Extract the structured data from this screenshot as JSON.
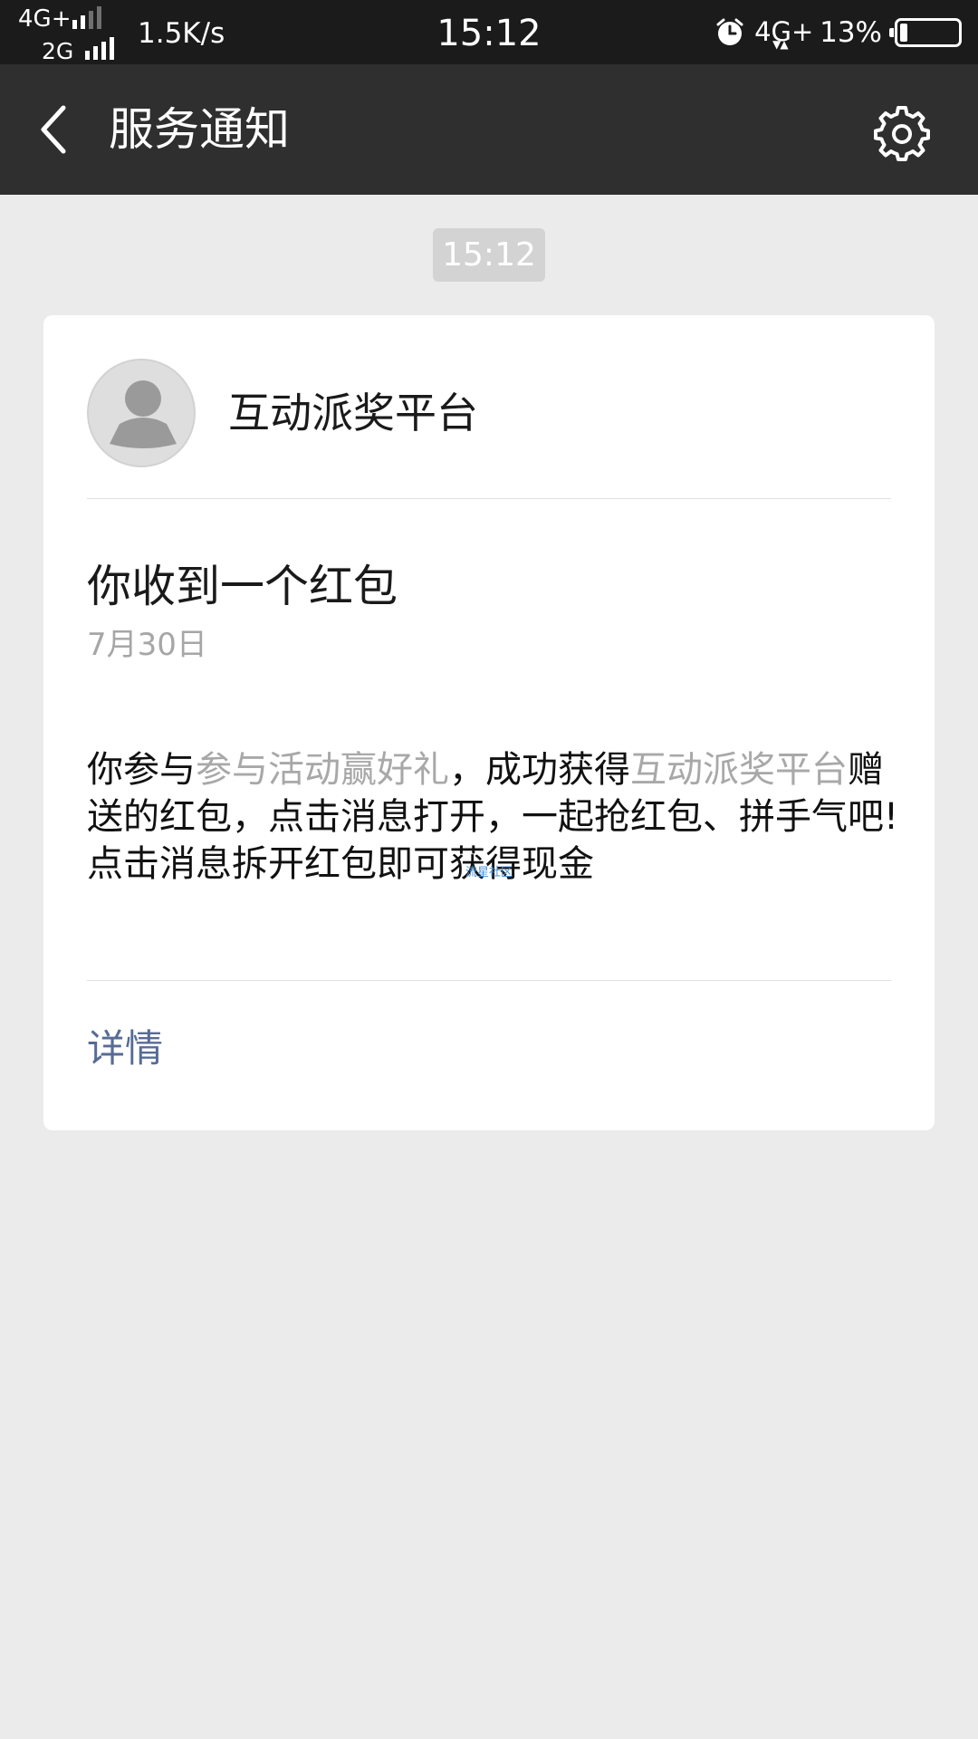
{
  "status_bar": {
    "network_top": "4G+",
    "network_bottom": "2G",
    "speed": "1.5K/s",
    "time": "15:12",
    "network_right": "4G+",
    "battery_percent": "13%",
    "battery_level": 0.13,
    "icons": [
      "signal-icon",
      "alarm-icon",
      "battery-icon"
    ]
  },
  "nav": {
    "title": "服务通知",
    "back_icon": "chevron-left-icon",
    "settings_icon": "gear-icon"
  },
  "timestamp": "15:12",
  "card": {
    "sender": "互动派奖平台",
    "avatar_icon": "default-user-avatar",
    "title": "你收到一个红包",
    "date": "7月30日",
    "body": {
      "part1": "你参与",
      "part2": "参与活动赢好礼",
      "part3": "，成功获得",
      "part4": "互动派奖平台",
      "part5": "赠送的红包，点击消息打开，一起抢红包、拼手气吧!",
      "line2": "点击消息拆开红包即可获得现金"
    },
    "watermark": "流星社区",
    "details_link": "详情"
  },
  "colors": {
    "status_bar_bg": "#1b1b1b",
    "nav_bg": "#2f2f2f",
    "page_bg": "#ebebeb",
    "link": "#576b95",
    "muted": "#a8a8a8"
  }
}
